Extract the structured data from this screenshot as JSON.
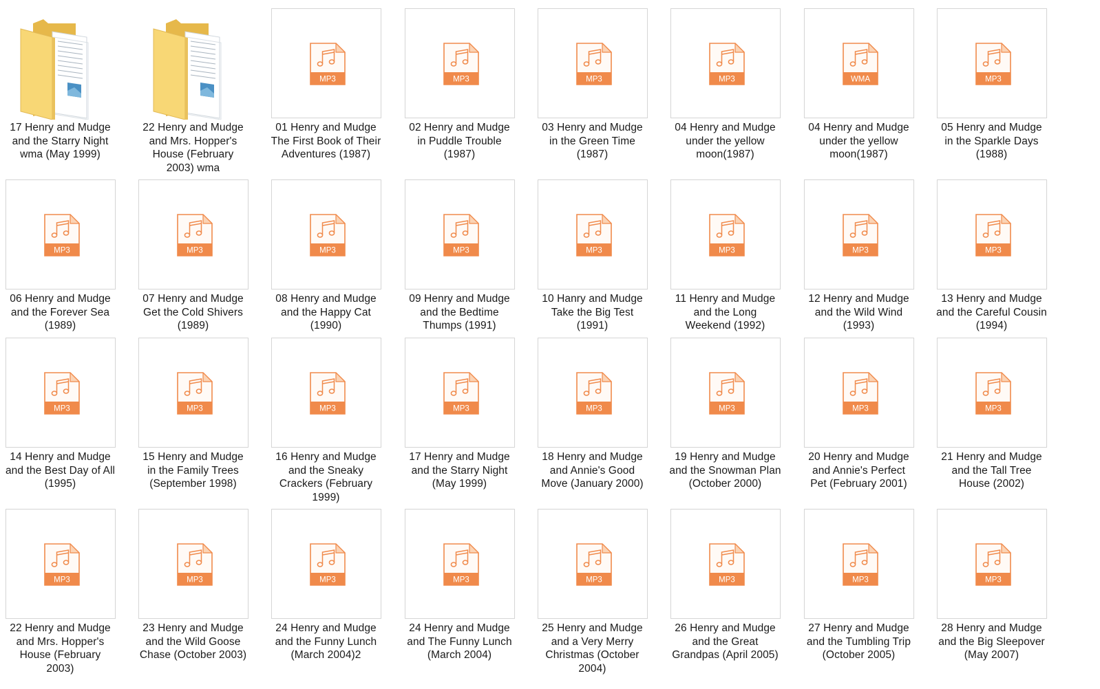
{
  "colors": {
    "file_accent": "#f08a4b",
    "file_tab": "#fbd3b4",
    "file_body": "#fffaf6",
    "folder_back": "#e6b84a",
    "folder_front": "#f8d775",
    "label_text": "#1a1a1a"
  },
  "items": [
    {
      "type": "folder",
      "icon": "folder-icon",
      "label": "17 Henry and Mudge\nand the Starry Night\nwma (May 1999)"
    },
    {
      "type": "folder",
      "icon": "folder-icon",
      "label": "22 Henry and Mudge\nand Mrs. Hopper's\nHouse (February\n2003) wma"
    },
    {
      "type": "file",
      "icon": "music-file-icon",
      "ext": "MP3",
      "label": "01 Henry and Mudge\nThe First Book of Their\nAdventures (1987)"
    },
    {
      "type": "file",
      "icon": "music-file-icon",
      "ext": "MP3",
      "label": "02 Henry and Mudge\nin Puddle Trouble\n(1987)"
    },
    {
      "type": "file",
      "icon": "music-file-icon",
      "ext": "MP3",
      "label": "03 Henry and Mudge\nin the Green Time\n(1987)"
    },
    {
      "type": "file",
      "icon": "music-file-icon",
      "ext": "MP3",
      "label": "04 Henry and Mudge\nunder the yellow\nmoon(1987)"
    },
    {
      "type": "file",
      "icon": "music-file-icon",
      "ext": "WMA",
      "label": "04 Henry and Mudge\nunder the yellow\nmoon(1987)"
    },
    {
      "type": "file",
      "icon": "music-file-icon",
      "ext": "MP3",
      "label": "05 Henry and Mudge\nin the Sparkle Days\n(1988)"
    },
    {
      "type": "file",
      "icon": "music-file-icon",
      "ext": "MP3",
      "label": "06 Henry and Mudge\nand the Forever Sea\n(1989)"
    },
    {
      "type": "file",
      "icon": "music-file-icon",
      "ext": "MP3",
      "label": "07 Henry and Mudge\nGet the Cold Shivers\n(1989)"
    },
    {
      "type": "file",
      "icon": "music-file-icon",
      "ext": "MP3",
      "label": "08 Henry and Mudge\nand the Happy Cat\n(1990)"
    },
    {
      "type": "file",
      "icon": "music-file-icon",
      "ext": "MP3",
      "label": "09 Henry and Mudge\nand the Bedtime\nThumps (1991)"
    },
    {
      "type": "file",
      "icon": "music-file-icon",
      "ext": "MP3",
      "label": "10 Hanry and Mudge\nTake the Big Test\n(1991)"
    },
    {
      "type": "file",
      "icon": "music-file-icon",
      "ext": "MP3",
      "label": "11 Henry and Mudge\nand the Long\nWeekend (1992)"
    },
    {
      "type": "file",
      "icon": "music-file-icon",
      "ext": "MP3",
      "label": "12 Henry and Mudge\nand the Wild Wind\n(1993)"
    },
    {
      "type": "file",
      "icon": "music-file-icon",
      "ext": "MP3",
      "label": "13 Henry and Mudge\nand the Careful Cousin\n(1994)"
    },
    {
      "type": "file",
      "icon": "music-file-icon",
      "ext": "MP3",
      "label": "14 Henry and Mudge\nand the Best Day of All\n(1995)"
    },
    {
      "type": "file",
      "icon": "music-file-icon",
      "ext": "MP3",
      "label": "15 Henry and Mudge\nin the Family Trees\n(September 1998)"
    },
    {
      "type": "file",
      "icon": "music-file-icon",
      "ext": "MP3",
      "label": "16 Henry and Mudge\nand the Sneaky\nCrackers (February\n1999)"
    },
    {
      "type": "file",
      "icon": "music-file-icon",
      "ext": "MP3",
      "label": "17 Henry and Mudge\nand the Starry Night\n(May 1999)"
    },
    {
      "type": "file",
      "icon": "music-file-icon",
      "ext": "MP3",
      "label": "18 Henry and Mudge\nand Annie's Good\nMove (January 2000)"
    },
    {
      "type": "file",
      "icon": "music-file-icon",
      "ext": "MP3",
      "label": "19 Henry and Mudge\nand the Snowman Plan\n(October 2000)"
    },
    {
      "type": "file",
      "icon": "music-file-icon",
      "ext": "MP3",
      "label": "20 Henry and Mudge\nand Annie's Perfect\nPet (February 2001)"
    },
    {
      "type": "file",
      "icon": "music-file-icon",
      "ext": "MP3",
      "label": "21 Henry and Mudge\nand the Tall Tree\nHouse (2002)"
    },
    {
      "type": "file",
      "icon": "music-file-icon",
      "ext": "MP3",
      "label": "22 Henry and Mudge\nand Mrs. Hopper's\nHouse (February\n2003)"
    },
    {
      "type": "file",
      "icon": "music-file-icon",
      "ext": "MP3",
      "label": "23 Henry and Mudge\nand the Wild Goose\nChase (October 2003)"
    },
    {
      "type": "file",
      "icon": "music-file-icon",
      "ext": "MP3",
      "label": "24  Henry and Mudge\nand the Funny Lunch\n(March 2004)2"
    },
    {
      "type": "file",
      "icon": "music-file-icon",
      "ext": "MP3",
      "label": "24 Henry and Mudge\nand The Funny Lunch\n(March 2004)"
    },
    {
      "type": "file",
      "icon": "music-file-icon",
      "ext": "MP3",
      "label": "25 Henry and Mudge\nand a Very Merry\nChristmas (October\n2004)"
    },
    {
      "type": "file",
      "icon": "music-file-icon",
      "ext": "MP3",
      "label": "26 Henry and Mudge\nand the Great\nGrandpas (April 2005)"
    },
    {
      "type": "file",
      "icon": "music-file-icon",
      "ext": "MP3",
      "label": "27 Henry and Mudge\nand the Tumbling Trip\n(October 2005)"
    },
    {
      "type": "file",
      "icon": "music-file-icon",
      "ext": "MP3",
      "label": "28 Henry and Mudge\nand the Big Sleepover\n(May 2007)"
    }
  ]
}
